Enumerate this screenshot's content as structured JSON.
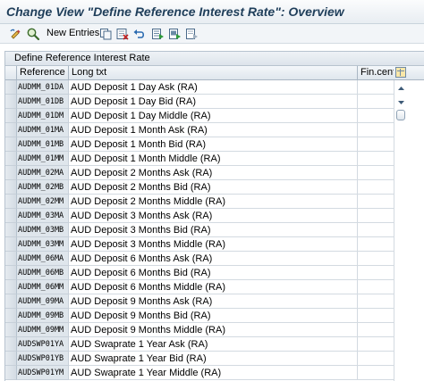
{
  "window": {
    "title": "Change View \"Define Reference Interest Rate\": Overview"
  },
  "toolbar": {
    "new_entries_label": "New Entries",
    "icons": [
      "display-change-icon",
      "find-icon",
      "copy-icon",
      "delete-icon",
      "undo-icon",
      "select-all-icon",
      "select-block-icon",
      "deselect-icon"
    ]
  },
  "table": {
    "caption": "Define Reference Interest Rate",
    "columns": {
      "reference": "Reference",
      "long_txt": "Long txt",
      "fin_center": "Fin.cente"
    },
    "rows": [
      {
        "reference": "AUDMM_01DA",
        "long_txt": "AUD Deposit 1 Day Ask (RA)"
      },
      {
        "reference": "AUDMM_01DB",
        "long_txt": "AUD Deposit 1 Day Bid (RA)"
      },
      {
        "reference": "AUDMM_01DM",
        "long_txt": "AUD Deposit 1 Day Middle (RA)"
      },
      {
        "reference": "AUDMM_01MA",
        "long_txt": "AUD Deposit 1 Month Ask (RA)"
      },
      {
        "reference": "AUDMM_01MB",
        "long_txt": "AUD Deposit 1 Month Bid (RA)"
      },
      {
        "reference": "AUDMM_01MM",
        "long_txt": "AUD Deposit 1 Month Middle (RA)"
      },
      {
        "reference": "AUDMM_02MA",
        "long_txt": "AUD Deposit 2 Months Ask (RA)"
      },
      {
        "reference": "AUDMM_02MB",
        "long_txt": "AUD Deposit 2 Months Bid (RA)"
      },
      {
        "reference": "AUDMM_02MM",
        "long_txt": "AUD Deposit 2 Months Middle (RA)"
      },
      {
        "reference": "AUDMM_03MA",
        "long_txt": "AUD Deposit 3 Months Ask (RA)"
      },
      {
        "reference": "AUDMM_03MB",
        "long_txt": "AUD Deposit 3 Months Bid (RA)"
      },
      {
        "reference": "AUDMM_03MM",
        "long_txt": "AUD Deposit 3 Months Middle (RA)"
      },
      {
        "reference": "AUDMM_06MA",
        "long_txt": "AUD Deposit 6 Months Ask (RA)"
      },
      {
        "reference": "AUDMM_06MB",
        "long_txt": "AUD Deposit 6 Months Bid (RA)"
      },
      {
        "reference": "AUDMM_06MM",
        "long_txt": "AUD Deposit 6 Months Middle (RA)"
      },
      {
        "reference": "AUDMM_09MA",
        "long_txt": "AUD Deposit 9 Months Ask (RA)"
      },
      {
        "reference": "AUDMM_09MB",
        "long_txt": "AUD Deposit 9 Months Bid (RA)"
      },
      {
        "reference": "AUDMM_09MM",
        "long_txt": "AUD Deposit 9 Months Middle (RA)"
      },
      {
        "reference": "AUDSWP01YA",
        "long_txt": "AUD Swaprate 1 Year Ask (RA)"
      },
      {
        "reference": "AUDSWP01YB",
        "long_txt": "AUD Swaprate 1 Year Bid (RA)"
      },
      {
        "reference": "AUDSWP01YM",
        "long_txt": "AUD Swaprate 1 Year Middle (RA)"
      }
    ]
  },
  "scrollbar": {
    "icons": [
      "scroll-up-icon",
      "scroll-down-icon"
    ]
  },
  "colors": {
    "title_text": "#1f3e5a",
    "key_column_bg": "#dfe6ec",
    "header_bg": "#dfe6ed"
  }
}
